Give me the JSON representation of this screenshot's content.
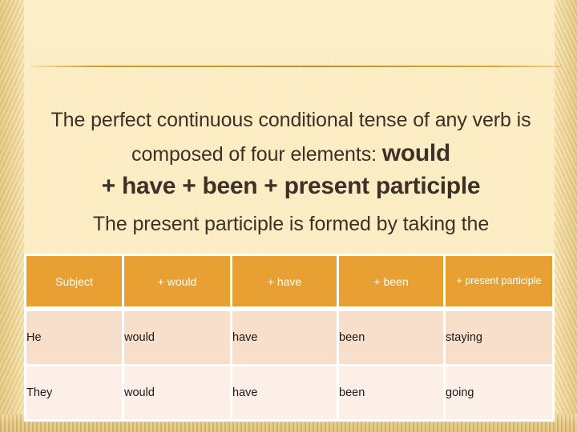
{
  "slide": {
    "title": "",
    "rule_color": "#D89B20",
    "background_color": "#FCEFC8",
    "text_color": "#3D3026"
  },
  "content": {
    "paragraph_lead_part1": "The perfect continuous conditional tense of any verb is composed of four elements: ",
    "paragraph_lead_emphasis": "would",
    "formula_line": "+ have + been + present participle",
    "paragraph_second": "The present participle is formed by taking the"
  },
  "table": {
    "header_bg": "#E8A033",
    "row_a_bg": "#F8DFCC",
    "row_b_bg": "#FCEFE8",
    "headers": [
      "Subject",
      "+ would",
      "+ have",
      "+ been",
      "+ present participle"
    ],
    "rows": [
      {
        "subject": "He",
        "would": "would",
        "have": "have",
        "been": "been",
        "participle": "staying"
      },
      {
        "subject": "They",
        "would": "would",
        "have": "have",
        "been": "been",
        "participle": "going"
      }
    ]
  }
}
